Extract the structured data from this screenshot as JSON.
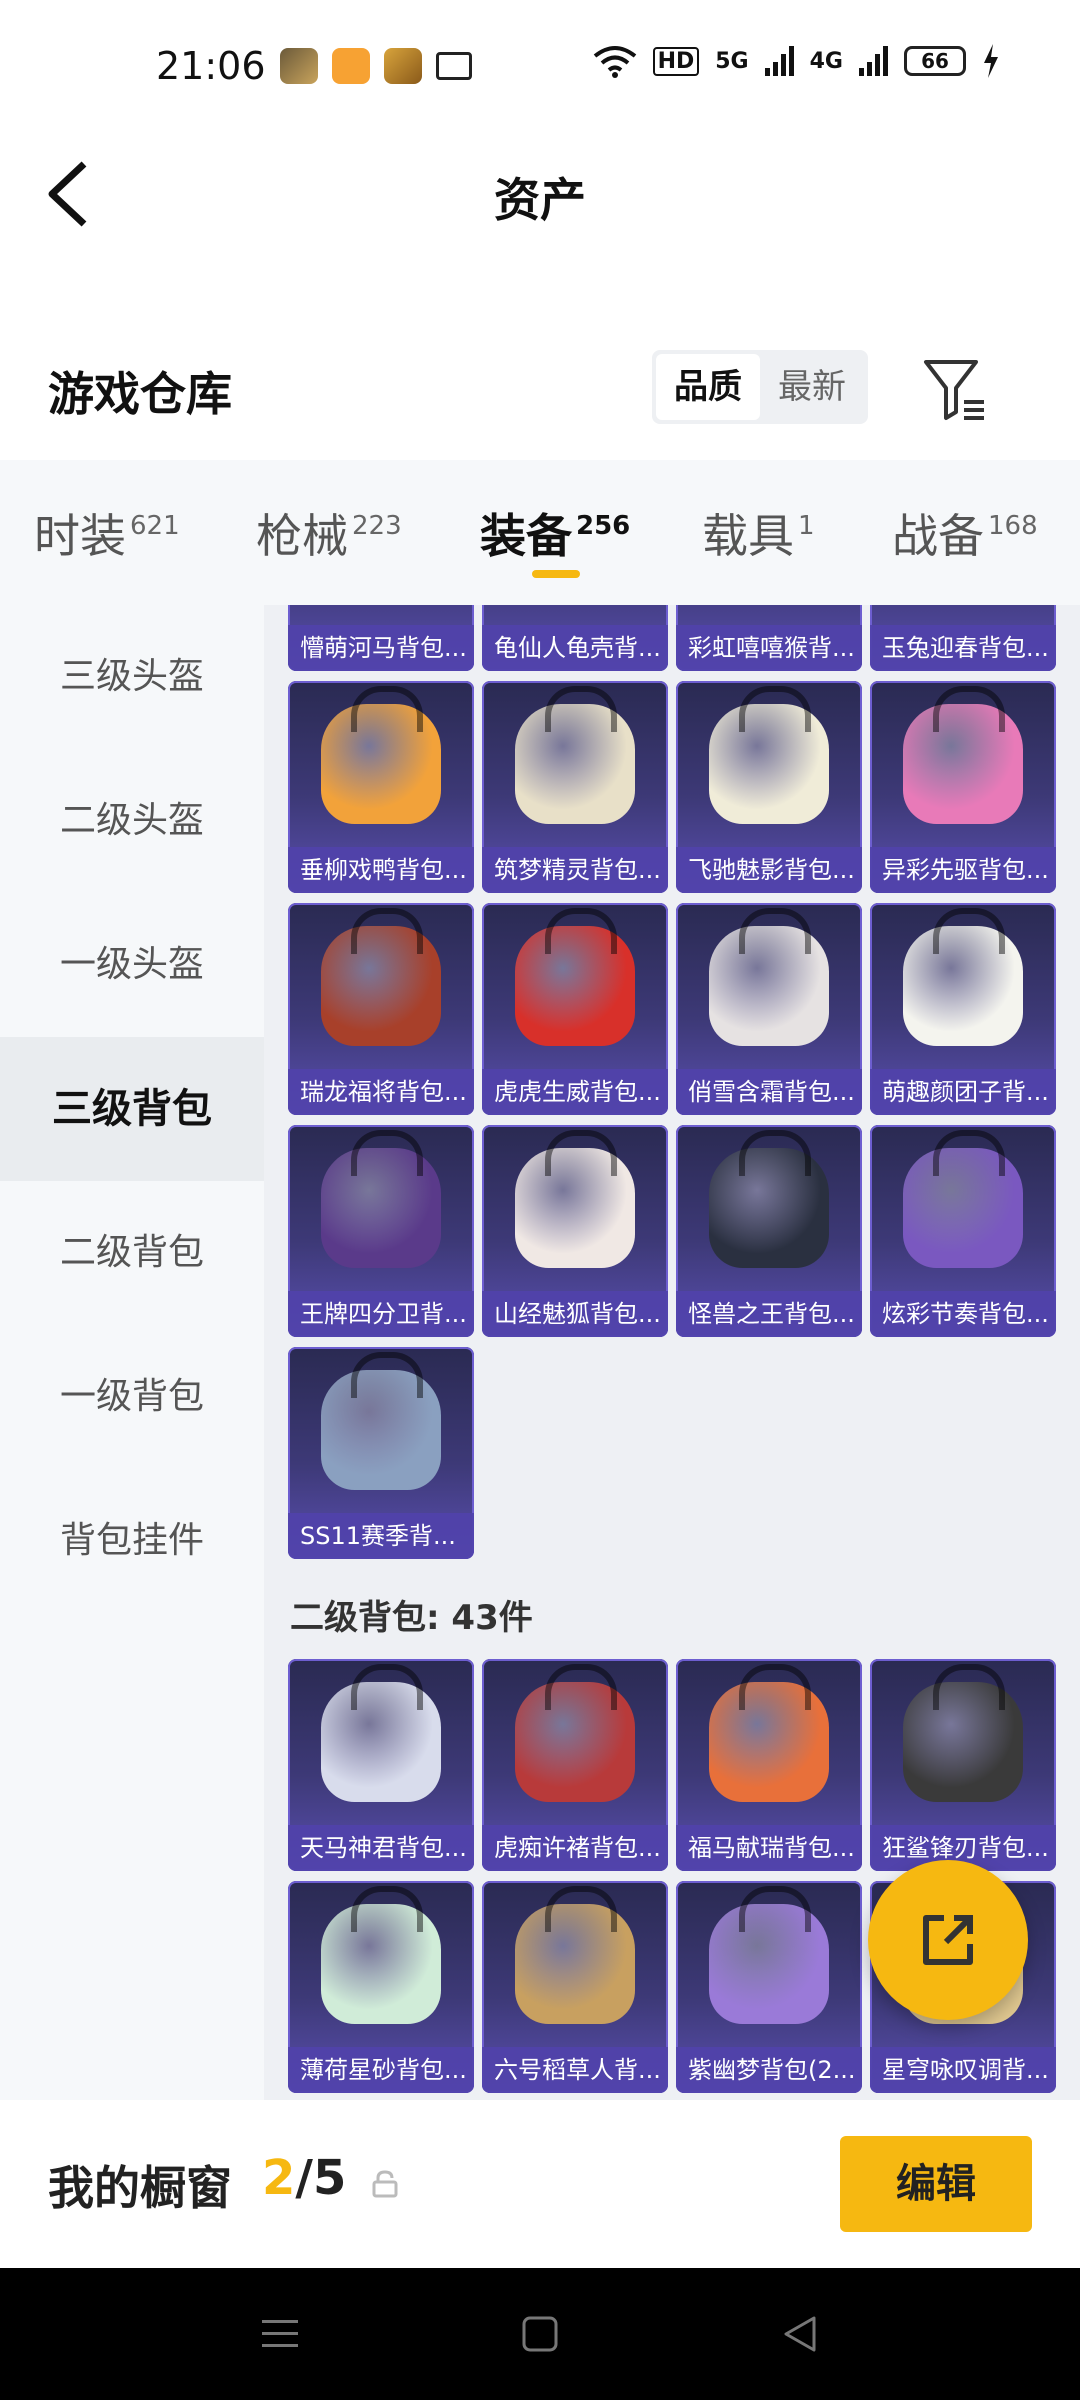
{
  "status": {
    "time": "21:06",
    "battery": "66",
    "network": [
      "HD",
      "5G",
      "4G"
    ]
  },
  "header": {
    "title": "资产"
  },
  "warehouse": {
    "title": "游戏仓库",
    "sort_options": [
      "品质",
      "最新"
    ],
    "sort_selected": "品质"
  },
  "tabs": [
    {
      "label": "时装",
      "count": "621"
    },
    {
      "label": "枪械",
      "count": "223"
    },
    {
      "label": "装备",
      "count": "256"
    },
    {
      "label": "载具",
      "count": "1"
    },
    {
      "label": "战备",
      "count": "168"
    }
  ],
  "active_tab": "装备",
  "sidebar": {
    "items": [
      "三级头盔",
      "二级头盔",
      "一级头盔",
      "三级背包",
      "二级背包",
      "一级背包",
      "背包挂件"
    ],
    "active": "三级背包"
  },
  "level3_items": [
    {
      "name": "懵萌河马背包...",
      "color": "#8a7bd0"
    },
    {
      "name": "龟仙人龟壳背...",
      "color": "#8a7bd0"
    },
    {
      "name": "彩虹嘻嘻猴背...",
      "color": "#8a7bd0"
    },
    {
      "name": "玉兔迎春背包...",
      "color": "#8a7bd0"
    },
    {
      "name": "垂柳戏鸭背包...",
      "color": "#f2a23a"
    },
    {
      "name": "筑梦精灵背包...",
      "color": "#e8e0c8"
    },
    {
      "name": "飞驰魅影背包...",
      "color": "#f0ecd8"
    },
    {
      "name": "异彩先驱背包...",
      "color": "#e87ab8"
    },
    {
      "name": "瑞龙福将背包...",
      "color": "#a8402a"
    },
    {
      "name": "虎虎生威背包...",
      "color": "#d8302a"
    },
    {
      "name": "俏雪含霜背包...",
      "color": "#e6e2e2"
    },
    {
      "name": "萌趣颜团子背...",
      "color": "#f4f4ee"
    },
    {
      "name": "王牌四分卫背...",
      "color": "#5a3a8a"
    },
    {
      "name": "山经魅狐背包...",
      "color": "#f0e8e4"
    },
    {
      "name": "怪兽之王背包...",
      "color": "#2a3040"
    },
    {
      "name": "炫彩节奏背包...",
      "color": "#7a58c0"
    },
    {
      "name": "SS11赛季背...",
      "color": "#8aa0c0"
    }
  ],
  "level2_section": {
    "title": "二级背包: 43件",
    "items": [
      {
        "name": "天马神君背包...",
        "color": "#d8dcec"
      },
      {
        "name": "虎痴许褚背包...",
        "color": "#b83a3a"
      },
      {
        "name": "福马献瑞背包...",
        "color": "#e8703a"
      },
      {
        "name": "狂鲨锋刃背包...",
        "color": "#3a3a3a"
      },
      {
        "name": "薄荷星砂背包...",
        "color": "#d0ecd8"
      },
      {
        "name": "六号稻草人背...",
        "color": "#c8a060"
      },
      {
        "name": "紫幽梦背包(2...",
        "color": "#9a7ad8"
      },
      {
        "name": "星穹咏叹调背...",
        "color": "#e0c890"
      }
    ]
  },
  "showcase": {
    "title": "我的橱窗",
    "current": "2",
    "total": "/5",
    "edit_label": "编辑"
  },
  "colors": {
    "accent": "#f6b811",
    "card_bg": "#3d3977",
    "card_label_bg": "#5042aa"
  }
}
